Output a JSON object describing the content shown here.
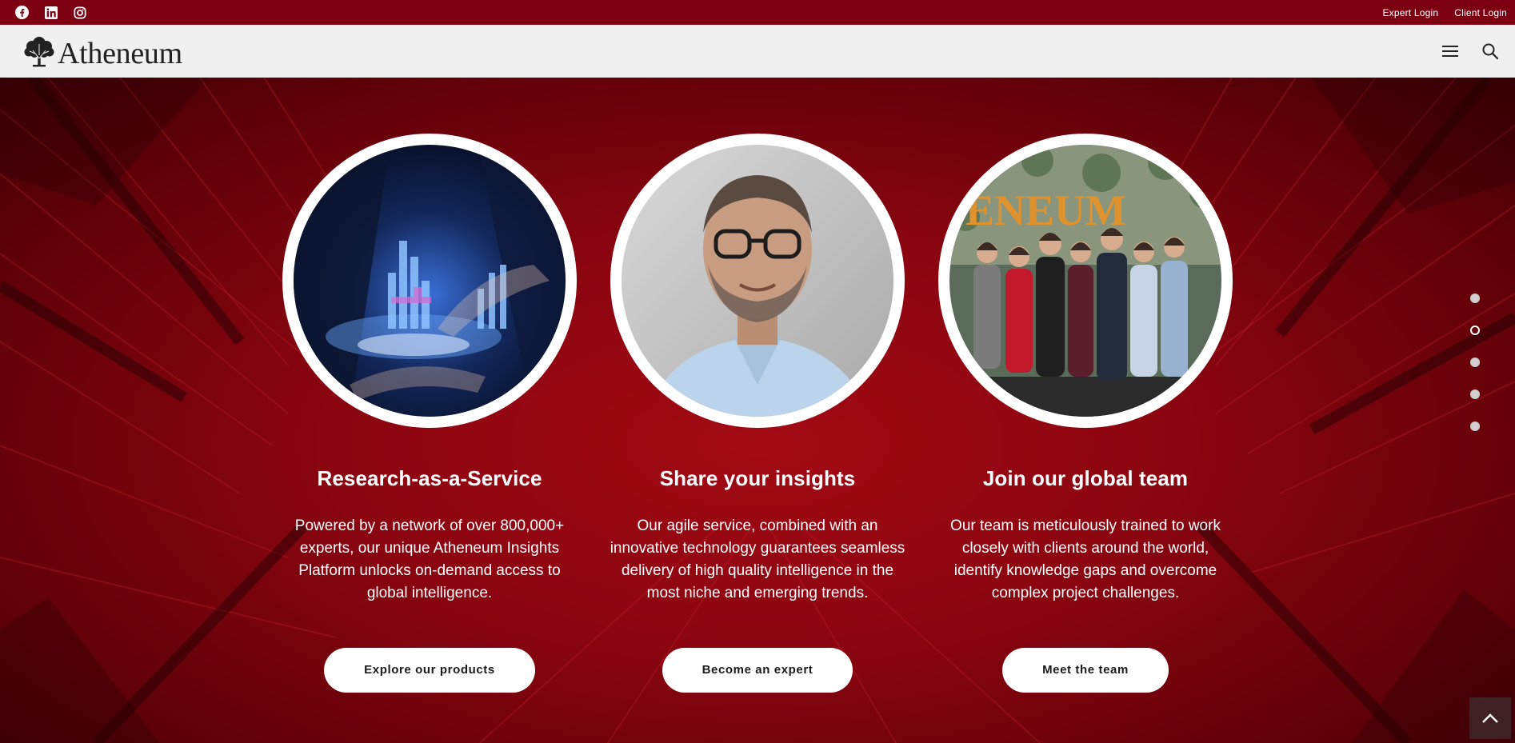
{
  "topbar": {
    "social_icons": [
      "facebook-icon",
      "linkedin-icon",
      "instagram-icon"
    ],
    "expert_login": "Expert Login",
    "client_login": "Client Login",
    "background_color": "#7d0012"
  },
  "navbar": {
    "brand": "Atheneum",
    "icons": [
      "hamburger-menu-icon",
      "search-icon"
    ]
  },
  "hero": {
    "accent_color": "#8a0510",
    "cards": [
      {
        "image": "digital-analytics-hands-image",
        "title": "Research-as-a-Service",
        "text": "Powered by a network of over 800,000+ experts, our unique Atheneum Insights Platform unlocks on-demand access to global intelligence.",
        "button": "Explore our products"
      },
      {
        "image": "smiling-expert-portrait-image",
        "title": "Share your insights",
        "text": "Our agile service, combined with an innovative technology guarantees seamless delivery of high quality intelligence in the most niche and emerging trends.",
        "button": "Become an expert"
      },
      {
        "image": "team-group-photo-image",
        "title": "Join our global team",
        "text": "Our team is meticulously trained to work closely with clients around the world, identify knowledge gaps and overcome complex project challenges.",
        "button": "Meet the team"
      }
    ],
    "slide_dots": [
      {
        "active": false
      },
      {
        "active": true
      },
      {
        "active": false
      },
      {
        "active": false
      },
      {
        "active": false
      }
    ]
  },
  "scroll_top": {
    "icon": "chevron-up-icon"
  }
}
